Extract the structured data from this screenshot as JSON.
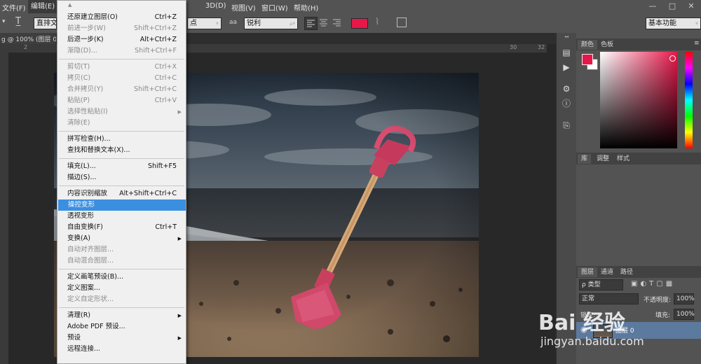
{
  "menubar": {
    "items": [
      "文件(F)",
      "编辑(E)",
      "3D(D)",
      "视图(V)",
      "窗口(W)",
      "帮助(H)"
    ],
    "win_min": "—",
    "win_max": "□",
    "win_close": "✕"
  },
  "options": {
    "tool_name": "直排文字工具",
    "size_value": "点",
    "aa_icon": "aa",
    "antialias": "锐利",
    "workspace": "基本功能",
    "text_color": "#e8174a"
  },
  "document": {
    "tab_title": "g @ 100% (图层 0",
    "ruler_numbers": [
      "2",
      "30",
      "32"
    ]
  },
  "menu": {
    "items": [
      {
        "label": "还原建立图层(O)",
        "shortcut": "Ctrl+Z",
        "state": "normal"
      },
      {
        "label": "前进一步(W)",
        "shortcut": "Shift+Ctrl+Z",
        "state": "disabled"
      },
      {
        "label": "后退一步(K)",
        "shortcut": "Alt+Ctrl+Z",
        "state": "normal"
      },
      {
        "label": "渐隐(D)...",
        "shortcut": "Shift+Ctrl+F",
        "state": "disabled"
      },
      {
        "label": "剪切(T)",
        "shortcut": "Ctrl+X",
        "state": "disabled"
      },
      {
        "label": "拷贝(C)",
        "shortcut": "Ctrl+C",
        "state": "disabled"
      },
      {
        "label": "合并拷贝(Y)",
        "shortcut": "Shift+Ctrl+C",
        "state": "disabled"
      },
      {
        "label": "粘贴(P)",
        "shortcut": "Ctrl+V",
        "state": "disabled"
      },
      {
        "label": "选择性粘贴(I)",
        "shortcut": "",
        "state": "disabled",
        "submenu": true
      },
      {
        "label": "清除(E)",
        "shortcut": "",
        "state": "disabled"
      },
      {
        "label": "拼写检查(H)...",
        "shortcut": "",
        "state": "normal"
      },
      {
        "label": "查找和替换文本(X)...",
        "shortcut": "",
        "state": "normal"
      },
      {
        "label": "填充(L)...",
        "shortcut": "Shift+F5",
        "state": "normal"
      },
      {
        "label": "描边(S)...",
        "shortcut": "",
        "state": "normal"
      },
      {
        "label": "内容识别缩放",
        "shortcut": "Alt+Shift+Ctrl+C",
        "state": "normal"
      },
      {
        "label": "操控变形",
        "shortcut": "",
        "state": "highlighted"
      },
      {
        "label": "透视变形",
        "shortcut": "",
        "state": "normal"
      },
      {
        "label": "自由变换(F)",
        "shortcut": "Ctrl+T",
        "state": "normal"
      },
      {
        "label": "变换(A)",
        "shortcut": "",
        "state": "normal",
        "submenu": true
      },
      {
        "label": "自动对齐图层...",
        "shortcut": "",
        "state": "disabled"
      },
      {
        "label": "自动混合图层...",
        "shortcut": "",
        "state": "disabled"
      },
      {
        "label": "定义画笔预设(B)...",
        "shortcut": "",
        "state": "normal"
      },
      {
        "label": "定义图案...",
        "shortcut": "",
        "state": "normal"
      },
      {
        "label": "定义自定形状...",
        "shortcut": "",
        "state": "disabled"
      },
      {
        "label": "清理(R)",
        "shortcut": "",
        "state": "normal",
        "submenu": true
      },
      {
        "label": "Adobe PDF 预设...",
        "shortcut": "",
        "state": "normal"
      },
      {
        "label": "预设",
        "shortcut": "",
        "state": "normal",
        "submenu": true
      },
      {
        "label": "远程连接...",
        "shortcut": "",
        "state": "normal"
      }
    ]
  },
  "color_panel": {
    "tabs": [
      "颜色",
      "色板"
    ],
    "foreground": "#e8174a",
    "background": "#ffffff"
  },
  "library_panel": {
    "tabs": [
      "库",
      "调整",
      "样式"
    ]
  },
  "layers_panel": {
    "tabs": [
      "图层",
      "通道",
      "路径"
    ],
    "filter": "ρ 类型",
    "blend_mode": "正常",
    "opacity_label": "不透明度:",
    "opacity_value": "100%",
    "lock_label": "锁定:",
    "fill_label": "填充:",
    "fill_value": "100%",
    "layer_name": "图层 0"
  },
  "watermark": {
    "brand": "Bai 经验",
    "url": "jingyan.baidu.com"
  }
}
